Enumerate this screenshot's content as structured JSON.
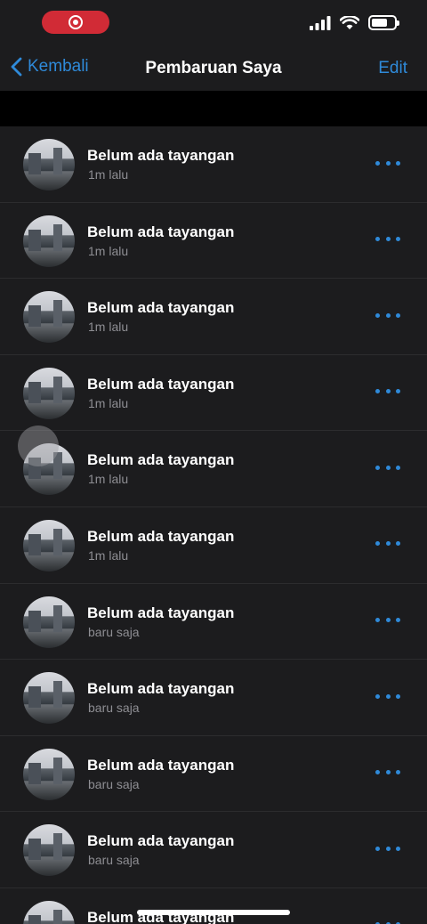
{
  "status_bar": {
    "recording_icon": "screen-record-icon",
    "signal_icon": "cellular-signal-icon",
    "wifi_icon": "wifi-icon",
    "battery_icon": "battery-icon",
    "battery_level": 0.7
  },
  "nav": {
    "back_label": "Kembali",
    "title": "Pembaruan Saya",
    "edit_label": "Edit"
  },
  "colors": {
    "accent": "#2f8ad9",
    "record": "#d12b36",
    "background": "#1c1c1e"
  },
  "updates": [
    {
      "title": "Belum ada tayangan",
      "time": "1m lalu"
    },
    {
      "title": "Belum ada tayangan",
      "time": "1m lalu"
    },
    {
      "title": "Belum ada tayangan",
      "time": "1m lalu"
    },
    {
      "title": "Belum ada tayangan",
      "time": "1m lalu"
    },
    {
      "title": "Belum ada tayangan",
      "time": "1m lalu"
    },
    {
      "title": "Belum ada tayangan",
      "time": "1m lalu"
    },
    {
      "title": "Belum ada tayangan",
      "time": "baru saja"
    },
    {
      "title": "Belum ada tayangan",
      "time": "baru saja"
    },
    {
      "title": "Belum ada tayangan",
      "time": "baru saja"
    },
    {
      "title": "Belum ada tayangan",
      "time": "baru saja"
    },
    {
      "title": "Belum ada tayangan",
      "time": ""
    }
  ]
}
